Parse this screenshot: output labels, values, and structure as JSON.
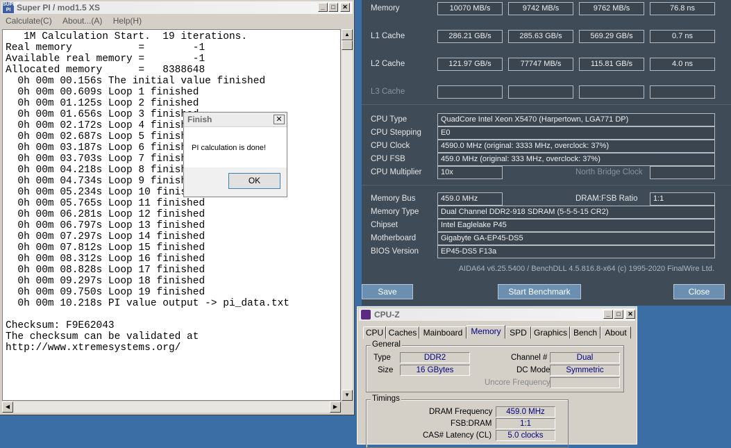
{
  "superpi": {
    "title": "Super PI / mod1.5 XS",
    "icon_text": "SUPER PI",
    "menu": [
      "Calculate(C)",
      "About...(A)",
      "Help(H)"
    ],
    "lines": [
      "   1M Calculation Start.  19 iterations.",
      "Real memory           =        -1",
      "Available real memory =        -1",
      "Allocated memory      =   8388648",
      "  0h 00m 00.156s The initial value finished",
      "  0h 00m 00.609s Loop 1 finished",
      "  0h 00m 01.125s Loop 2 finished",
      "  0h 00m 01.656s Loop 3 finished",
      "  0h 00m 02.172s Loop 4 finished",
      "  0h 00m 02.687s Loop 5 finished",
      "  0h 00m 03.187s Loop 6 finished",
      "  0h 00m 03.703s Loop 7 finished",
      "  0h 00m 04.218s Loop 8 finished",
      "  0h 00m 04.734s Loop 9 finished",
      "  0h 00m 05.234s Loop 10 finished",
      "  0h 00m 05.765s Loop 11 finished",
      "  0h 00m 06.281s Loop 12 finished",
      "  0h 00m 06.797s Loop 13 finished",
      "  0h 00m 07.297s Loop 14 finished",
      "  0h 00m 07.812s Loop 15 finished",
      "  0h 00m 08.312s Loop 16 finished",
      "  0h 00m 08.828s Loop 17 finished",
      "  0h 00m 09.297s Loop 18 finished",
      "  0h 00m 09.750s Loop 19 finished",
      "  0h 00m 10.218s PI value output -> pi_data.txt",
      "",
      "Checksum: F9E62043",
      "The checksum can be validated at",
      "http://www.xtremesystems.org/"
    ]
  },
  "finish_dialog": {
    "title": "Finish",
    "message": "PI calculation is done!",
    "ok_label": "OK",
    "close_glyph": "✕"
  },
  "aida": {
    "rows": [
      {
        "label": "Memory",
        "values": [
          "10070 MB/s",
          "9742 MB/s",
          "9762 MB/s",
          "76.8 ns"
        ]
      },
      {
        "label": "L1 Cache",
        "values": [
          "286.21 GB/s",
          "285.63 GB/s",
          "569.29 GB/s",
          "0.7 ns"
        ]
      },
      {
        "label": "L2 Cache",
        "values": [
          "121.97 GB/s",
          "77747 MB/s",
          "115.81 GB/s",
          "4.0 ns"
        ]
      },
      {
        "label": "L3 Cache",
        "values": [
          "",
          "",
          "",
          ""
        ]
      }
    ],
    "cpu_type_label": "CPU Type",
    "cpu_type": "QuadCore Intel Xeon X5470  (Harpertown, LGA771 DP)",
    "cpu_stepping_label": "CPU Stepping",
    "cpu_stepping": "E0",
    "cpu_clock_label": "CPU Clock",
    "cpu_clock": "4590.0 MHz  (original: 3333 MHz, overclock: 37%)",
    "cpu_fsb_label": "CPU FSB",
    "cpu_fsb": "459.0 MHz  (original: 333 MHz, overclock: 37%)",
    "cpu_multiplier_label": "CPU Multiplier",
    "cpu_multiplier": "10x",
    "nb_clock_label": "North Bridge Clock",
    "nb_clock": "",
    "memory_bus_label": "Memory Bus",
    "memory_bus": "459.0 MHz",
    "dram_ratio_label": "DRAM:FSB Ratio",
    "dram_ratio": "1:1",
    "memory_type_label": "Memory Type",
    "memory_type": "Dual Channel DDR2-918 SDRAM  (5-5-5-15 CR2)",
    "chipset_label": "Chipset",
    "chipset": "Intel Eaglelake P45",
    "motherboard_label": "Motherboard",
    "motherboard": "Gigabyte GA-EP45-DS5",
    "bios_label": "BIOS Version",
    "bios": "EP45-DS5 F13a",
    "footer": "AIDA64 v6.25.5400 / BenchDLL 4.5.816.8-x64  (c) 1995-2020 FinalWire Ltd.",
    "save_label": "Save",
    "start_label": "Start Benchmark",
    "close_label": "Close"
  },
  "cpuz": {
    "title": "CPU-Z",
    "tabs": [
      "CPU",
      "Caches",
      "Mainboard",
      "Memory",
      "SPD",
      "Graphics",
      "Bench",
      "About"
    ],
    "active_tab": "Memory",
    "general_title": "General",
    "type_label": "Type",
    "type": "DDR2",
    "size_label": "Size",
    "size": "16 GBytes",
    "channel_label": "Channel #",
    "channel": "Dual",
    "dcmode_label": "DC Mode",
    "dcmode": "Symmetric",
    "uncore_label": "Uncore Frequency",
    "uncore": "",
    "timings_title": "Timings",
    "dram_freq_label": "DRAM Frequency",
    "dram_freq": "459.0 MHz",
    "fsb_dram_label": "FSB:DRAM",
    "fsb_dram": "1:1",
    "cas_label": "CAS# Latency (CL)",
    "cas": "5.0 clocks"
  },
  "colors": {
    "desktop": "#3a6ea5",
    "aida_bg": "#3f4b57",
    "cpuz_value": "#000080"
  }
}
